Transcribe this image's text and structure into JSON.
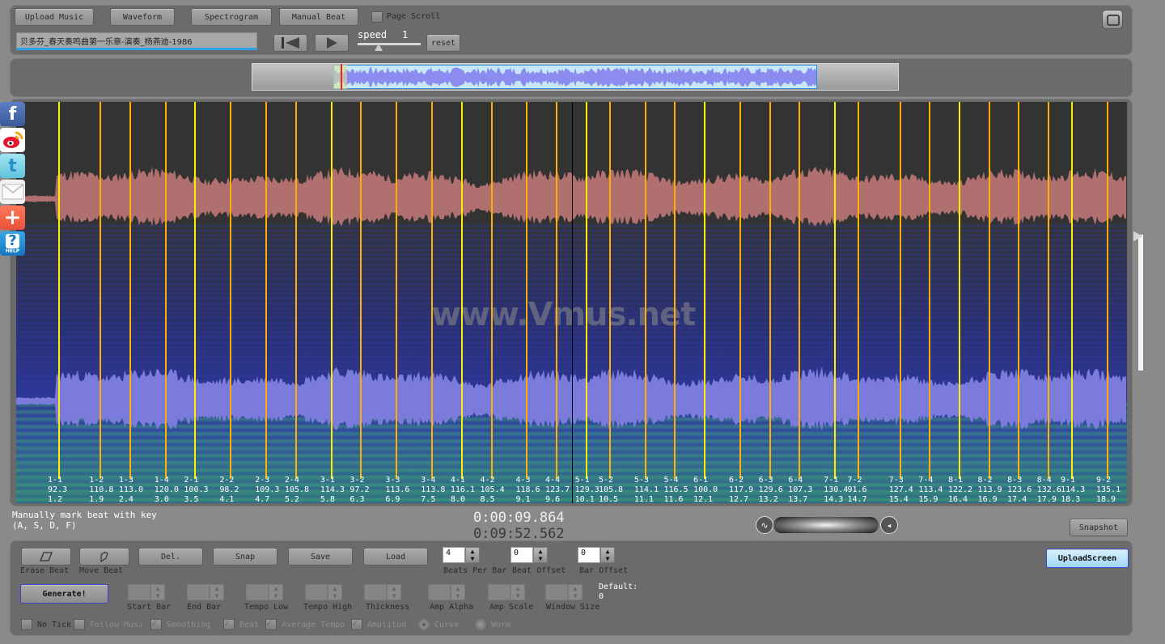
{
  "toolbar": {
    "upload_music": "Upload Music",
    "waveform": "Waveform",
    "spectrogram": "Spectrogram",
    "manual_beat": "Manual Beat",
    "page_scroll_label": "Page Scroll",
    "page_scroll_checked": false
  },
  "player": {
    "song_title": "贝多芬_春天奏鸣曲第一乐章-演奏_杨燕迪-1986",
    "speed_label": "speed",
    "speed_value": "1",
    "reset_label": "reset",
    "speed_fraction": 0.35
  },
  "overview": {
    "selection_start_fraction": 0.125,
    "selection_end_fraction": 0.875,
    "playhead_fraction": 0.137
  },
  "icons": {
    "social": [
      "facebook-icon",
      "weibo-icon",
      "twitter-icon",
      "email-icon",
      "add-share-icon",
      "help-icon"
    ],
    "help_label": "HELP"
  },
  "canvas": {
    "watermark": "www.Vmus.net",
    "colors": {
      "bar_start_beat": "#ffee00",
      "beat": "#ffb000",
      "waveform": "#b07070",
      "spectrogram_wave": "#7b7bdc"
    },
    "cursor_time": 9.864
  },
  "beats": [
    {
      "label": "1-1",
      "tempo": "92.3",
      "time": "1.2"
    },
    {
      "label": "1-2",
      "tempo": "110.8",
      "time": "1.9"
    },
    {
      "label": "1-3",
      "tempo": "113.0",
      "time": "2.4"
    },
    {
      "label": "1-4",
      "tempo": "120.0",
      "time": "3.0"
    },
    {
      "label": "2-1",
      "tempo": "100.3",
      "time": "3.5"
    },
    {
      "label": "2-2",
      "tempo": "98.2",
      "time": "4.1"
    },
    {
      "label": "2-3",
      "tempo": "109.3",
      "time": "4.7"
    },
    {
      "label": "2-4",
      "tempo": "105.8",
      "time": "5.2"
    },
    {
      "label": "3-1",
      "tempo": "114.3",
      "time": "5.8"
    },
    {
      "label": "3-2",
      "tempo": "97.2",
      "time": "6.3"
    },
    {
      "label": "3-3",
      "tempo": "113.6",
      "time": "6.9"
    },
    {
      "label": "3-4",
      "tempo": "113.8",
      "time": "7.5"
    },
    {
      "label": "4-1",
      "tempo": "116.1",
      "time": "8.0"
    },
    {
      "label": "4-2",
      "tempo": "105.4",
      "time": "8.5"
    },
    {
      "label": "4-3",
      "tempo": "118.6",
      "time": "9.1"
    },
    {
      "label": "4-4",
      "tempo": "123.7",
      "time": "9.6"
    },
    {
      "label": "5-1",
      "tempo": "129.3",
      "time": "10.1"
    },
    {
      "label": "5-2",
      "tempo": "105.8",
      "time": "10.5"
    },
    {
      "label": "5-3",
      "tempo": "114.1",
      "time": "11.1"
    },
    {
      "label": "5-4",
      "tempo": "116.5",
      "time": "11.6"
    },
    {
      "label": "6-1",
      "tempo": "100.0",
      "time": "12.1"
    },
    {
      "label": "6-2",
      "tempo": "117.9",
      "time": "12.7"
    },
    {
      "label": "6-3",
      "tempo": "129.6",
      "time": "13.2"
    },
    {
      "label": "6-4",
      "tempo": "107.3",
      "time": "13.7"
    },
    {
      "label": "7-1",
      "tempo": "130.4",
      "time": "14.3"
    },
    {
      "label": "7-2",
      "tempo": "91.6",
      "time": "14.7"
    },
    {
      "label": "7-3",
      "tempo": "127.4",
      "time": "15.4"
    },
    {
      "label": "7-4",
      "tempo": "113.4",
      "time": "15.9"
    },
    {
      "label": "8-1",
      "tempo": "122.2",
      "time": "16.4"
    },
    {
      "label": "8-2",
      "tempo": "113.9",
      "time": "16.9"
    },
    {
      "label": "8-3",
      "tempo": "123.6",
      "time": "17.4"
    },
    {
      "label": "8-4",
      "tempo": "132.6",
      "time": "17.9"
    },
    {
      "label": "9-1",
      "tempo": "114.3",
      "time": "18.3"
    },
    {
      "label": "9-2",
      "tempo": "135.1",
      "time": "18.9"
    }
  ],
  "info": {
    "manual_hint": "Manually mark beat with key\n(A, S, D, F)",
    "time_current": "0:00:09.864",
    "time_total": "0:09:52.562",
    "snapshot": "Snapshot"
  },
  "bottom": {
    "erase_beat": "Erase Beat",
    "move_beat": "Move Beat",
    "del": "Del.",
    "snap": "Snap",
    "save": "Save",
    "load": "Load",
    "beats_per_bar_value": "4",
    "beats_per_bar_label": "Beats Per Bar",
    "beat_offset_value": "0",
    "beat_offset_label": "Beat Offset",
    "bar_offset_value": "0",
    "bar_offset_label": "Bar Offset",
    "upload_screen": "UploadScreen",
    "generate": "Generate!",
    "start_bar": "Start Bar",
    "end_bar": "End Bar",
    "tempo_low": "Tempo Low",
    "tempo_high": "Tempo High",
    "thickness": "Thickness",
    "amp_alpha": "Amp Alpha",
    "amp_scale": "Amp Scale",
    "window_size": "Window Size",
    "default_label": "Default:",
    "default_value": "0",
    "no_tick": "No Tick",
    "follow_music": "Follow Musi",
    "smoothing": "Smoothing",
    "beat": "Beat",
    "average_tempo": "Average Tempo",
    "amplitude": "Amplitud",
    "curve": "Curve",
    "worm": "Worm",
    "checks": {
      "no_tick": false,
      "follow_music": false,
      "smoothing": true,
      "beat": true,
      "average_tempo": true,
      "amplitude": true
    },
    "radio_selected": "curve"
  }
}
